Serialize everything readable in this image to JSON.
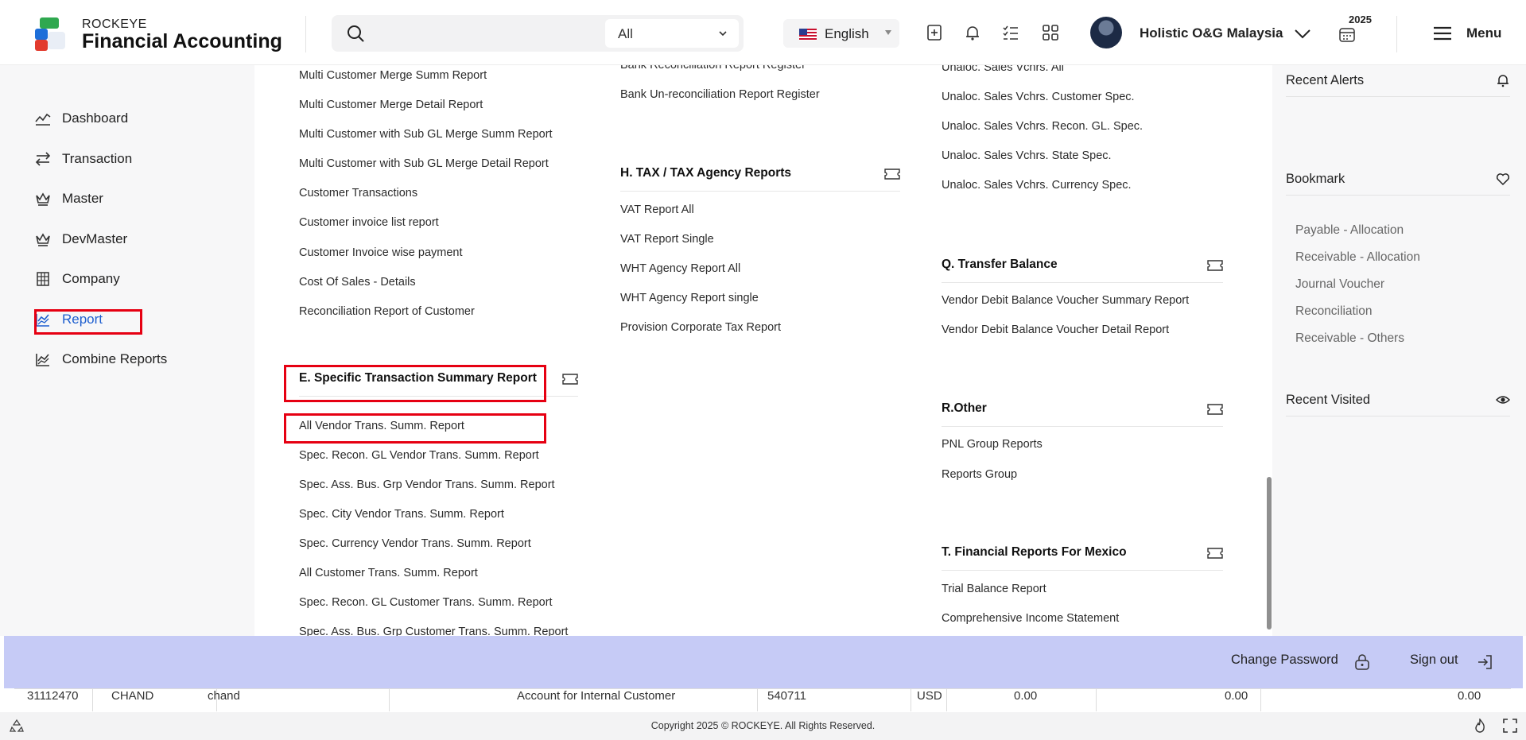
{
  "header": {
    "brand_top": "ROCKEYE",
    "brand_main": "Financial Accounting",
    "search_placeholder": "",
    "search_scope": "All",
    "language": "English",
    "user_name": "Holistic O&G Malaysia",
    "year": "2025",
    "menu_label": "Menu"
  },
  "sidebar": {
    "items": [
      {
        "label": "Dashboard",
        "icon": "chart-line-icon"
      },
      {
        "label": "Transaction",
        "icon": "arrows-exchange-icon"
      },
      {
        "label": "Master",
        "icon": "crown-icon"
      },
      {
        "label": "DevMaster",
        "icon": "crown-icon"
      },
      {
        "label": "Company",
        "icon": "building-icon"
      },
      {
        "label": "Report",
        "icon": "report-chart-icon",
        "active": true
      },
      {
        "label": "Combine Reports",
        "icon": "report-chart-icon"
      }
    ]
  },
  "content": {
    "col1_links_top": [
      "Multi Customer Merge Summ Report",
      "Multi Customer Merge Detail Report",
      "Multi Customer with Sub GL Merge Summ Report",
      "Multi Customer with Sub GL Merge Detail Report",
      "Customer Transactions",
      "Customer invoice list report",
      "Customer Invoice wise payment",
      "Cost Of Sales - Details",
      "Reconciliation Report of Customer"
    ],
    "section_e": {
      "title": "E. Specific Transaction Summary Report",
      "links": [
        "All Vendor Trans. Summ. Report",
        "Spec. Recon. GL Vendor Trans. Summ. Report",
        "Spec. Ass. Bus. Grp Vendor Trans. Summ. Report",
        "Spec. City Vendor Trans. Summ. Report",
        "Spec. Currency Vendor Trans. Summ. Report",
        "All Customer Trans. Summ. Report",
        "Spec. Recon. GL Customer Trans. Summ. Report",
        "Spec. Ass. Bus. Grp Customer Trans. Summ. Report"
      ]
    },
    "col2_links_top": [
      "Bank Reconciliation Report Register",
      "Bank Un-reconciliation Report Register"
    ],
    "section_h": {
      "title": "H. TAX / TAX Agency Reports",
      "links": [
        "VAT Report All",
        "VAT Report Single",
        "WHT Agency Report All",
        "WHT Agency Report single",
        "Provision Corporate Tax Report"
      ]
    },
    "col3_links_top": [
      "Unaloc. Sales Vchrs. All",
      "Unaloc. Sales Vchrs. Customer Spec.",
      "Unaloc. Sales Vchrs. Recon. GL. Spec.",
      "Unaloc. Sales Vchrs. State Spec.",
      "Unaloc. Sales Vchrs. Currency Spec."
    ],
    "section_q": {
      "title": "Q. Transfer Balance",
      "links": [
        "Vendor Debit Balance Voucher Summary Report",
        "Vendor Debit Balance Voucher Detail Report"
      ]
    },
    "section_r": {
      "title": "R.Other",
      "links": [
        "PNL Group Reports",
        "Reports Group"
      ]
    },
    "section_t": {
      "title": "T. Financial Reports For Mexico",
      "links": [
        "Trial Balance Report",
        "Comprehensive Income Statement"
      ]
    }
  },
  "right_panel": {
    "recent_alerts": "Recent Alerts",
    "bookmark": "Bookmark",
    "bookmarks": [
      "Payable - Allocation",
      "Receivable - Allocation",
      "Journal Voucher",
      "Reconciliation",
      "Receivable - Others"
    ],
    "recent_visited": "Recent Visited"
  },
  "bottom_bar": {
    "change_password": "Change Password",
    "sign_out": "Sign out"
  },
  "table_row": [
    "31112470",
    "CHAND",
    "chand",
    "Account for Internal Customer",
    "540711",
    "USD",
    "0.00",
    "0.00",
    "0.00"
  ],
  "footer": {
    "copyright": "Copyright 2025 © ROCKEYE. All Rights Reserved."
  },
  "colors": {
    "accent": "#1e5fcf",
    "highlight": "#e60012",
    "bottom_bar": "#c6cbf6"
  }
}
